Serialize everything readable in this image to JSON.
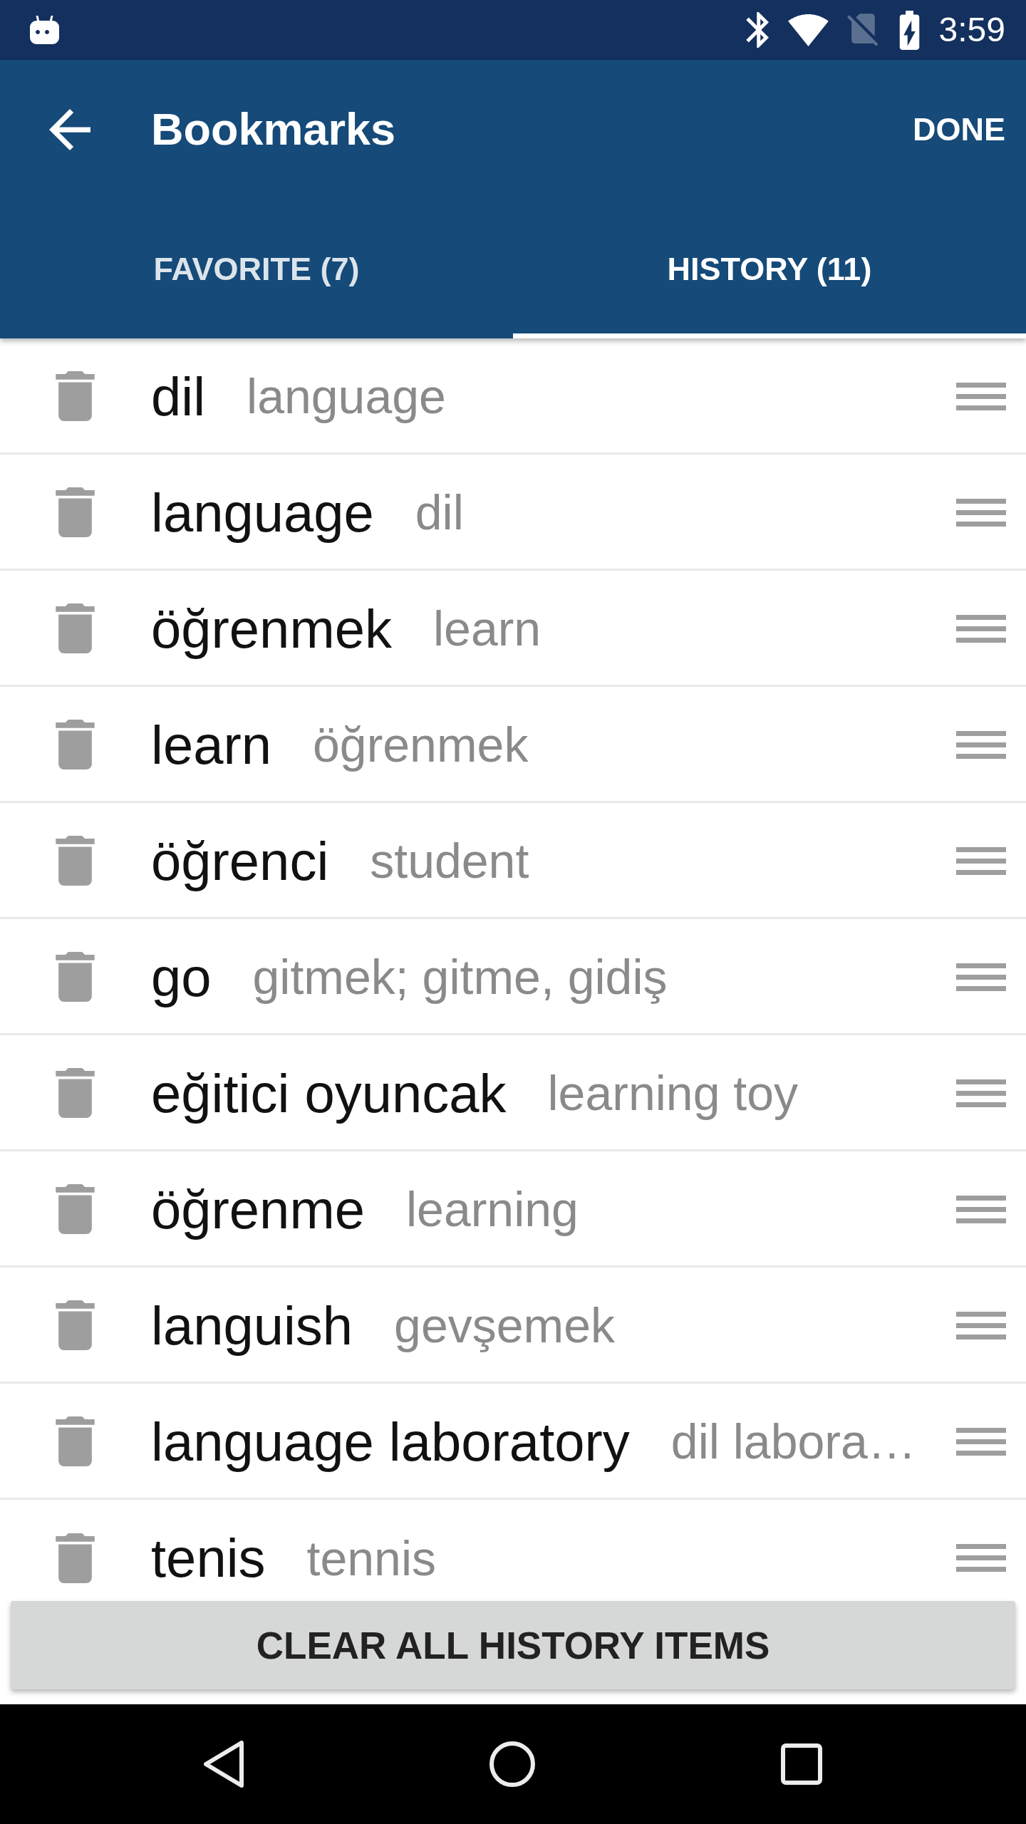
{
  "status_bar": {
    "time": "3:59"
  },
  "app_bar": {
    "title": "Bookmarks",
    "action": "DONE"
  },
  "tabs": [
    {
      "label": "FAVORITE (7)",
      "selected": false
    },
    {
      "label": "HISTORY (11)",
      "selected": true
    }
  ],
  "history": [
    {
      "word": "dil",
      "meaning": "language"
    },
    {
      "word": "language",
      "meaning": "dil"
    },
    {
      "word": "öğrenmek",
      "meaning": "learn"
    },
    {
      "word": "learn",
      "meaning": "öğrenmek"
    },
    {
      "word": "öğrenci",
      "meaning": "student"
    },
    {
      "word": "go",
      "meaning": "gitmek; gitme, gidiş"
    },
    {
      "word": "eğitici oyuncak",
      "meaning": "learning toy"
    },
    {
      "word": "öğrenme",
      "meaning": "learning"
    },
    {
      "word": "languish",
      "meaning": "gevşemek"
    },
    {
      "word": "language laboratory",
      "meaning": "dil labora…"
    },
    {
      "word": "tenis",
      "meaning": "tennis"
    }
  ],
  "clear_button": {
    "label": "CLEAR ALL HISTORY ITEMS"
  }
}
